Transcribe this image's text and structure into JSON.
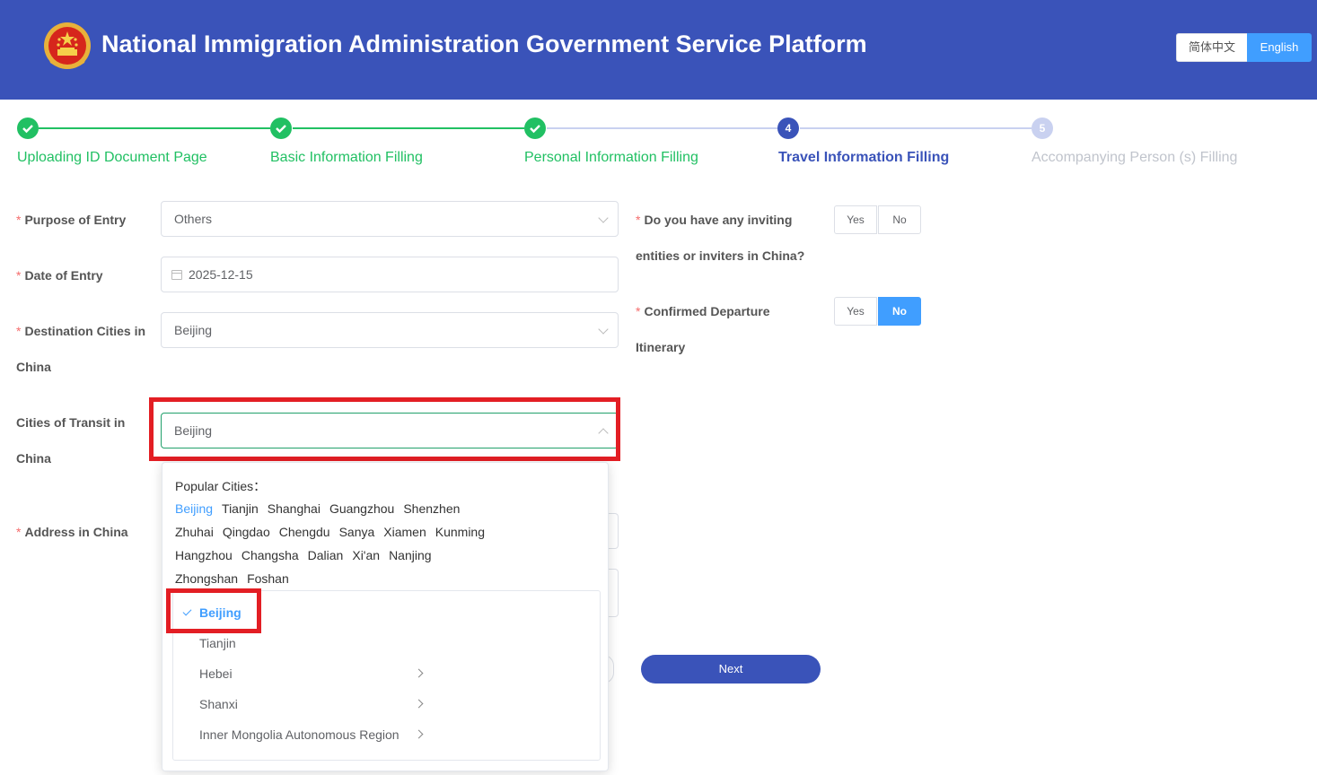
{
  "header": {
    "title": "National Immigration Administration Government Service Platform",
    "lang_cn": "简体中文",
    "lang_en": "English",
    "emblem_color": "#d6261c"
  },
  "steps": [
    {
      "number": "",
      "label": "Uploading ID Document Page",
      "state": "done"
    },
    {
      "number": "",
      "label": "Basic Information Filling",
      "state": "done"
    },
    {
      "number": "",
      "label": "Personal Information Filling",
      "state": "done"
    },
    {
      "number": "4",
      "label": "Travel Information Filling",
      "state": "active"
    },
    {
      "number": "5",
      "label": "Accompanying Person (s) Filling",
      "state": "wait"
    }
  ],
  "form": {
    "purpose": {
      "label": "Purpose of Entry",
      "value": "Others"
    },
    "date": {
      "label": "Date of Entry",
      "value": "2025-12-15"
    },
    "destination": {
      "label_line1": "Destination Cities in",
      "label_line2": "China",
      "value": "Beijing"
    },
    "transit": {
      "label_line1": "Cities of Transit in",
      "label_line2": "China",
      "value": "Beijing"
    },
    "address": {
      "label": "Address in China"
    },
    "inviting": {
      "label_line1": "Do you have any inviting",
      "label_line2": "entities or inviters in China?",
      "yes": "Yes",
      "no": "No",
      "selected": ""
    },
    "departure": {
      "label_line1": "Confirmed Departure",
      "label_line2": "Itinerary",
      "yes": "Yes",
      "no": "No",
      "selected": "No"
    },
    "next_label": "Next"
  },
  "dropdown": {
    "popular_title": "Popular Cities：",
    "popular_rows": [
      [
        "Beijing",
        "Tianjin",
        "Shanghai",
        "Guangzhou",
        "Shenzhen"
      ],
      [
        "Zhuhai",
        "Qingdao",
        "Chengdu",
        "Sanya",
        "Xiamen",
        "Kunming"
      ],
      [
        "Hangzhou",
        "Changsha",
        "Dalian",
        "Xi'an",
        "Nanjing"
      ],
      [
        "Zhongshan",
        "Foshan"
      ]
    ],
    "selected_popular": "Beijing",
    "list": [
      {
        "label": "Beijing",
        "selected": true,
        "has_children": false
      },
      {
        "label": "Tianjin",
        "selected": false,
        "has_children": false
      },
      {
        "label": "Hebei",
        "selected": false,
        "has_children": true
      },
      {
        "label": "Shanxi",
        "selected": false,
        "has_children": true
      },
      {
        "label": "Inner Mongolia Autonomous Region",
        "selected": false,
        "has_children": true
      }
    ]
  },
  "colors": {
    "primary": "#3a53b9",
    "accent": "#409eff",
    "done": "#21c063",
    "highlight": "#e31e24"
  }
}
